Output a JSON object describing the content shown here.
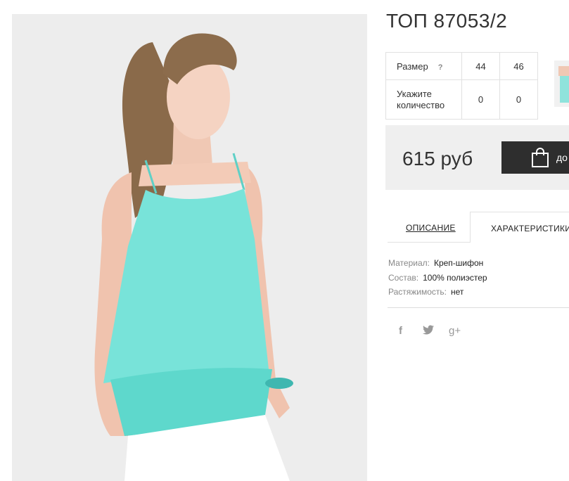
{
  "product": {
    "title": "ТОП 87053/2",
    "size_label": "Размер",
    "size_help": "?",
    "sizes": [
      "44",
      "46"
    ],
    "qty_label": "Укажите количество",
    "quantities": [
      "0",
      "0"
    ],
    "price": "615 руб",
    "buy_label": "до"
  },
  "tabs": {
    "description": "ОПИСАНИЕ",
    "characteristics": "ХАРАКТЕРИСТИКИ"
  },
  "specs": [
    {
      "name": "Материал:",
      "value": "Креп-шифон"
    },
    {
      "name": "Состав:",
      "value": "100% полиэстер"
    },
    {
      "name": "Растяжимость:",
      "value": "нет"
    }
  ],
  "social": {
    "facebook": "f",
    "google": "g+"
  },
  "colors": {
    "top": "#6fe0d6",
    "buy_button": "#2e2e2e",
    "price_bg": "#efefef"
  }
}
